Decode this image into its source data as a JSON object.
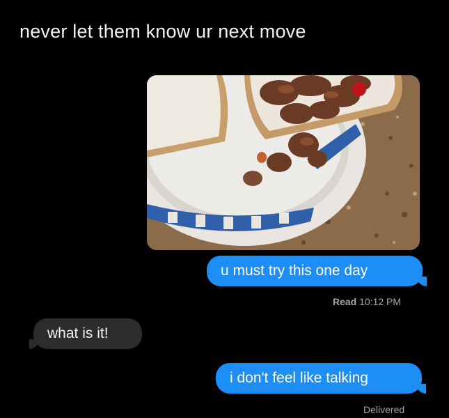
{
  "caption": "never let them know ur next move",
  "thread": {
    "photo": {
      "description_icon": "food-photo"
    },
    "messages": [
      {
        "text": "u must try this one day",
        "direction": "outgoing"
      },
      {
        "text": "what is it!",
        "direction": "incoming"
      },
      {
        "text": "i don't feel like talking",
        "direction": "outgoing"
      }
    ],
    "read_receipt": {
      "label": "Read",
      "time": "10:12 PM"
    },
    "delivered_label": "Delivered"
  },
  "colors": {
    "background": "#000000",
    "outgoing_bubble": "#1d8ef6",
    "incoming_bubble": "#2c2c2e",
    "status_text": "#a6a6ab"
  }
}
